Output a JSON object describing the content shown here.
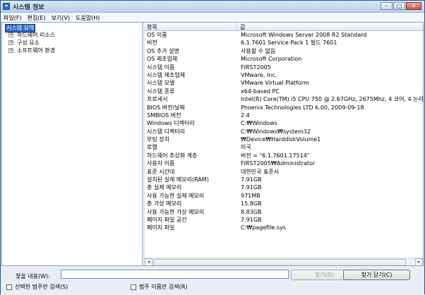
{
  "window": {
    "title": "시스템 정보",
    "minimize": "–",
    "maximize": "□",
    "close": "✕"
  },
  "menu": [
    "파일(F)",
    "편집(E)",
    "보기(V)",
    "도움말(H)"
  ],
  "tree": {
    "root": "시스템 요약",
    "items": [
      {
        "expander": "+",
        "label": "하드웨어 리소스"
      },
      {
        "expander": "+",
        "label": "구성 요소"
      },
      {
        "expander": "+",
        "label": "소프트웨어 환경"
      }
    ]
  },
  "columns": {
    "item": "항목",
    "value": "값"
  },
  "rows": [
    {
      "item": "OS 이름",
      "value": "Microsoft Windows Server 2008 R2 Standard"
    },
    {
      "item": "버전",
      "value": "6.1.7601 Service Pack 1 빌드 7601"
    },
    {
      "item": "OS 추가 설명",
      "value": "사용할 수 없음"
    },
    {
      "item": "OS 제조업체",
      "value": "Microsoft Corporation"
    },
    {
      "item": "시스템 이름",
      "value": "FIRST2005"
    },
    {
      "item": "시스템 제조업체",
      "value": "VMware, Inc."
    },
    {
      "item": "시스템 모델",
      "value": "VMware Virtual Platform"
    },
    {
      "item": "시스템 종류",
      "value": "x64-based PC"
    },
    {
      "item": "프로세서",
      "value": "Intel(R) Core(TM) i5 CPU       750  @ 2.67GHz, 2675Mhz, 4 코어, 4 논리"
    },
    {
      "item": "BIOS 버전/날짜",
      "value": "Phoenix Technologies LTD 6.00, 2009-09-18"
    },
    {
      "item": "SMBIOS 버전",
      "value": "2.4"
    },
    {
      "item": "Windows 디렉터리",
      "value": "C:₩Windows"
    },
    {
      "item": "시스템 디렉터리",
      "value": "C:₩Windows₩system32"
    },
    {
      "item": "부팅 장치",
      "value": "₩Device₩HarddiskVolume1"
    },
    {
      "item": "로캘",
      "value": "미국"
    },
    {
      "item": "하드웨어 추상화 계층",
      "value": "버전 = \"6.1.7601.17514\""
    },
    {
      "item": "사용자 이름",
      "value": "FIRST2005₩Administrator"
    },
    {
      "item": "표준 시간대",
      "value": "대한민국 표준시"
    },
    {
      "item": "설치된 실제 메모리(RAM)",
      "value": "7.91GB"
    },
    {
      "item": "총 실제 메모리",
      "value": "7.91GB"
    },
    {
      "item": "사용 가능한 실제 메모리",
      "value": "971MB"
    },
    {
      "item": "총 가상 메모리",
      "value": "15.8GB"
    },
    {
      "item": "사용 가능한 가상 메모리",
      "value": "8.83GB"
    },
    {
      "item": "페이지 파일 공간",
      "value": "7.91GB"
    },
    {
      "item": "페이지 파일",
      "value": "C:₩pagefile.sys"
    }
  ],
  "scroll": {
    "left": "◂",
    "right": "▸"
  },
  "find": {
    "label": "찾을 내용(W):",
    "value": "",
    "find_button": "찾기(D)",
    "close_find_button": "찾기 닫기(C)",
    "search_selected": "선택한 범주만 검색(S)",
    "search_category_names": "범주 이름만 검색(R)"
  }
}
